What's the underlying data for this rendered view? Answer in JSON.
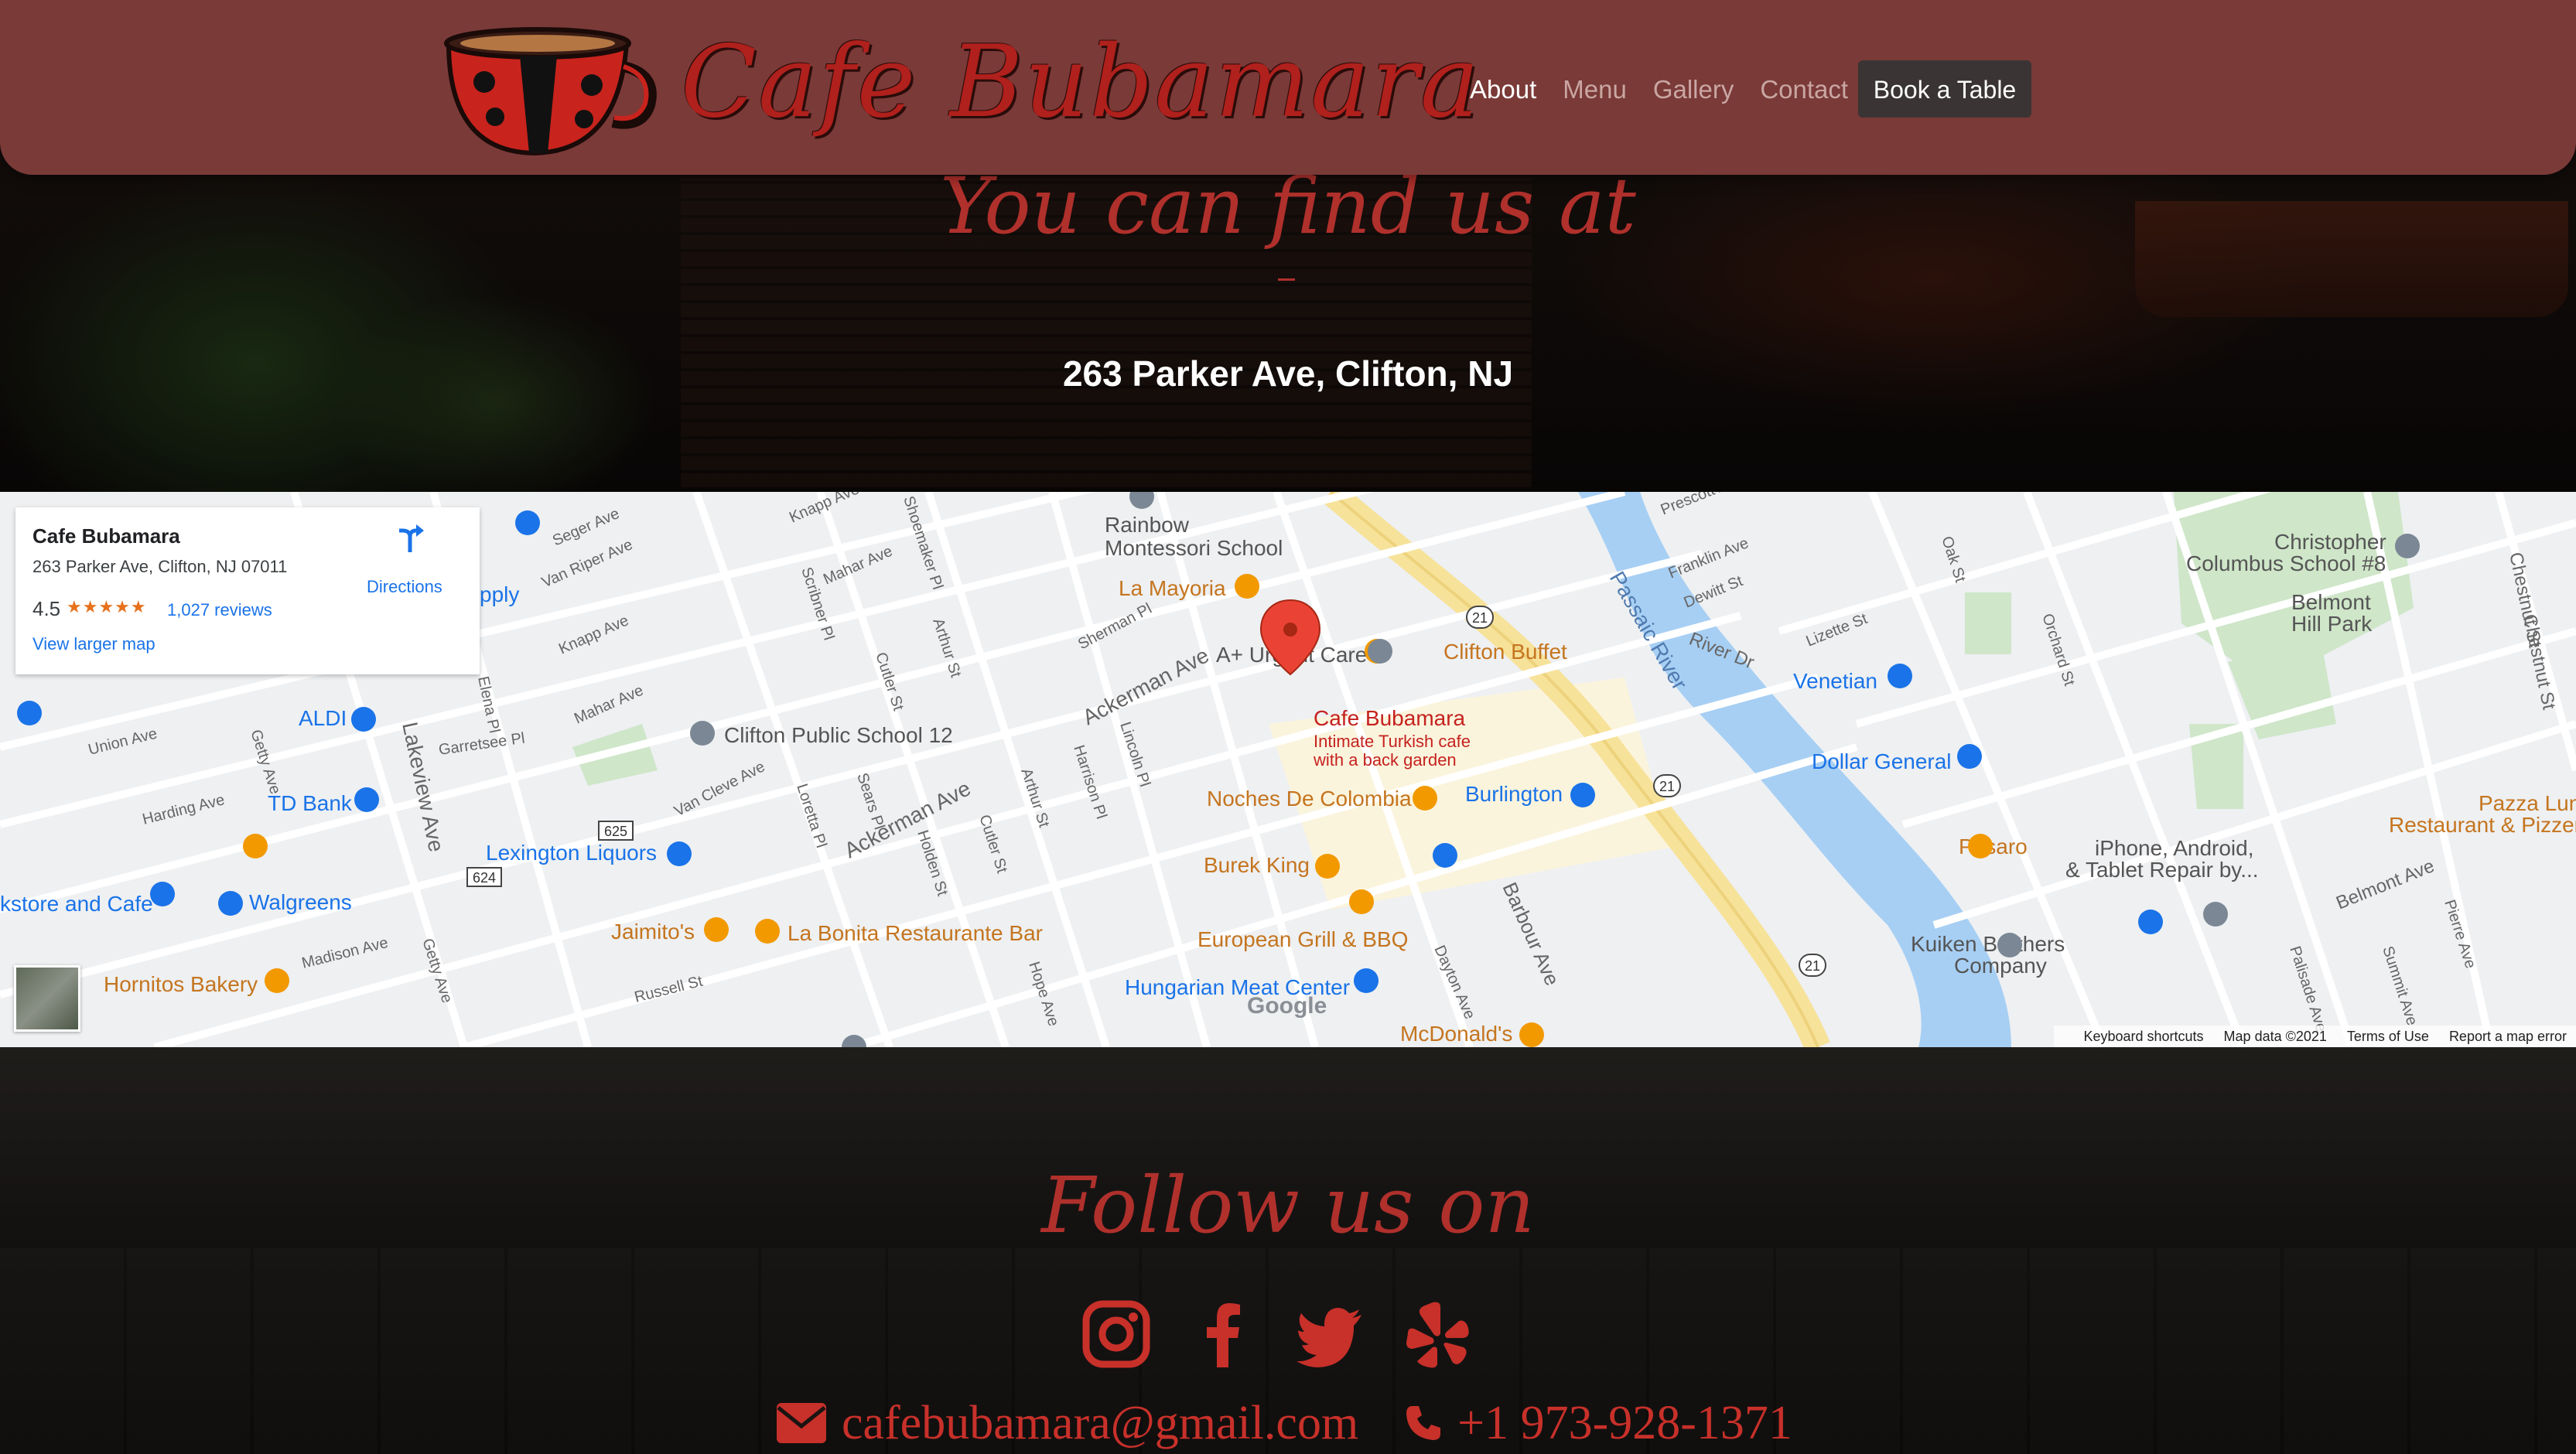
{
  "header": {
    "brand": "Cafe Bubamara",
    "nav": [
      "About",
      "Menu",
      "Gallery",
      "Contact"
    ],
    "active_nav": "About",
    "cta": "Book a Table",
    "colors": {
      "header_bg": "#7a3a38",
      "brand_red": "#b0201c",
      "button_bg": "#3a3434"
    }
  },
  "find": {
    "title": "You can find us at",
    "address": "263 Parker Ave, Clifton, NJ"
  },
  "map": {
    "card": {
      "name": "Cafe Bubamara",
      "address": "263 Parker Ave, Clifton, NJ 07011",
      "rating": "4.5",
      "stars": "★★★★★",
      "reviews": "1,027 reviews",
      "larger_map": "View larger map",
      "directions": "Directions"
    },
    "pin": {
      "title": "Cafe Bubamara",
      "sub1": "Intimate Turkish cafe",
      "sub2": "with a back garden"
    },
    "places": [
      "Rainbow Montessori School",
      "La Mayoria",
      "A+ Urgent Care",
      "Clifton Buffet",
      "Clifton Public School 12",
      "Noches De Colombia",
      "Burlington",
      "Burek King",
      "European Grill & BBQ",
      "Hungarian Meat Center",
      "McDonald's",
      "Jaimito's",
      "La Bonita Restaurante Bar",
      "Lexington Liquors",
      "ALDI",
      "TD Bank",
      "Walgreens",
      "Hornitos Bakery",
      "Venetian",
      "Dollar General",
      "Pesaro",
      "Kuiken Brothers Company",
      "Christopher Columbus School #8",
      "Belmont Hill Park",
      "iPhone, Android, & Tablet Repair by...",
      "Pazza Lun Restaurant & Pizzer",
      "kstore and Cafe",
      "pply",
      "Passaic River"
    ],
    "streets": [
      "Seger Ave",
      "Van Riper Ave",
      "Knapp Ave",
      "Mahar Ave",
      "Union Ave",
      "Harding Ave",
      "Madison Ave",
      "Russell St",
      "Ackerman Ave",
      "Van Cleve Ave",
      "Lakeview Ave",
      "Garretsee Pl",
      "Barbour Ave",
      "Dayton Ave",
      "Belmont Ave",
      "Franklin Ave",
      "Dewitt St",
      "Lizette St",
      "River Dr",
      "Prescott Ave",
      "Orchard St",
      "Oak St",
      "Chestnut St",
      "Summit Ave",
      "Palisade Ave",
      "Pierre Ave",
      "Sherman Pl",
      "Lincoln Pl",
      "Harrison Pl",
      "Arthur St",
      "Cutler St",
      "Sears Pl",
      "Loretta Pl",
      "Holden St",
      "Hope Ave",
      "Scribner Pl",
      "Shoemaker Pl",
      "Getty Ave",
      "Elena Pl"
    ],
    "route_labels": [
      "21",
      "625",
      "624"
    ],
    "zoom_in": "+",
    "zoom_out": "−",
    "google": "Google",
    "footer": [
      "Keyboard shortcuts",
      "Map data ©2021",
      "Terms of Use",
      "Report a map error"
    ]
  },
  "follow": {
    "title": "Follow us on",
    "icons": [
      "instagram-icon",
      "facebook-icon",
      "twitter-icon",
      "yelp-icon"
    ],
    "email": "cafebubamara@gmail.com",
    "phone": "+1 973-928-1371",
    "accent": "#c8302a"
  }
}
